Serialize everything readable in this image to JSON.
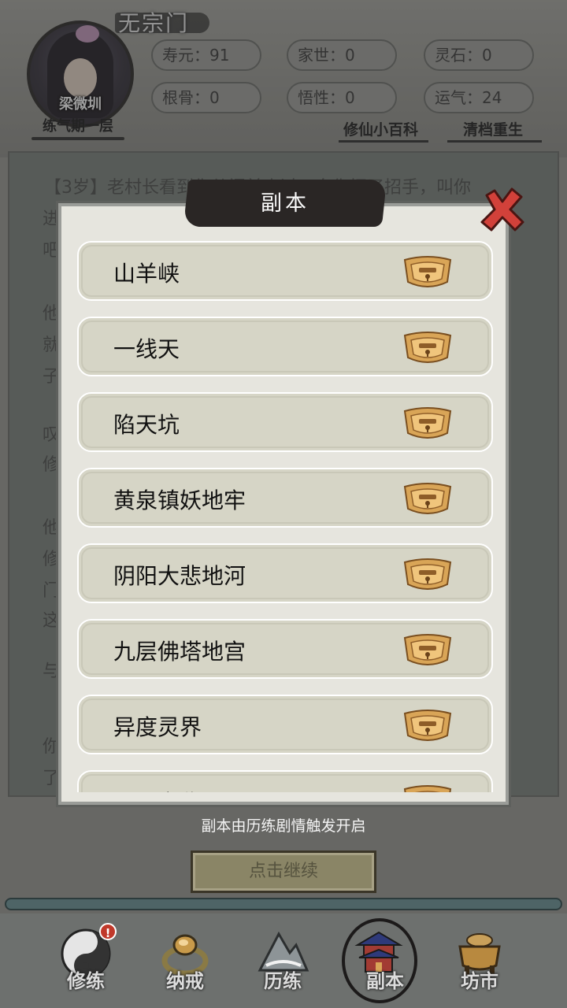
{
  "header": {
    "sect": "无宗门",
    "character_name": "梁微圳",
    "realm": "练气期一层",
    "stats": [
      {
        "label": "寿元：91"
      },
      {
        "label": "家世：0"
      },
      {
        "label": "灵石：0"
      },
      {
        "label": "根骨：0"
      },
      {
        "label": "悟性：0"
      },
      {
        "label": "运气：24"
      }
    ],
    "links": {
      "wiki": "修仙小百科",
      "reset": "清档重生"
    }
  },
  "story": {
    "lines": [
      "【3岁】老村长看到你从门前走过，向你招了招手，叫你",
      "进",
      "吧",
      "他",
      "就",
      "子",
      "叹",
      "修",
      "他",
      "修",
      "门",
      "这",
      "与",
      "你",
      "了"
    ]
  },
  "dialog": {
    "title": "副本",
    "entries": [
      {
        "label": "山羊峡"
      },
      {
        "label": "一线天"
      },
      {
        "label": "陷天坑"
      },
      {
        "label": "黄泉镇妖地牢"
      },
      {
        "label": "阴阳大悲地河"
      },
      {
        "label": "九层佛塔地宫"
      },
      {
        "label": "异度灵界"
      },
      {
        "label": "冥界之秘"
      }
    ]
  },
  "hint": "副本由历练剧情触发开启",
  "continue_label": "点击继续",
  "nav": {
    "items": [
      {
        "label": "修练",
        "icon": "yin-yang-icon",
        "badge": "!"
      },
      {
        "label": "纳戒",
        "icon": "ring-icon"
      },
      {
        "label": "历练",
        "icon": "mountain-icon"
      },
      {
        "label": "副本",
        "icon": "pagoda-icon"
      },
      {
        "label": "坊市",
        "icon": "cauldron-icon"
      }
    ]
  },
  "colors": {
    "lock_gold": "#d9a557",
    "close_red": "#d2413a",
    "dialog_bg": "#e6e5de",
    "entry_bg": "#d6d5c6"
  }
}
